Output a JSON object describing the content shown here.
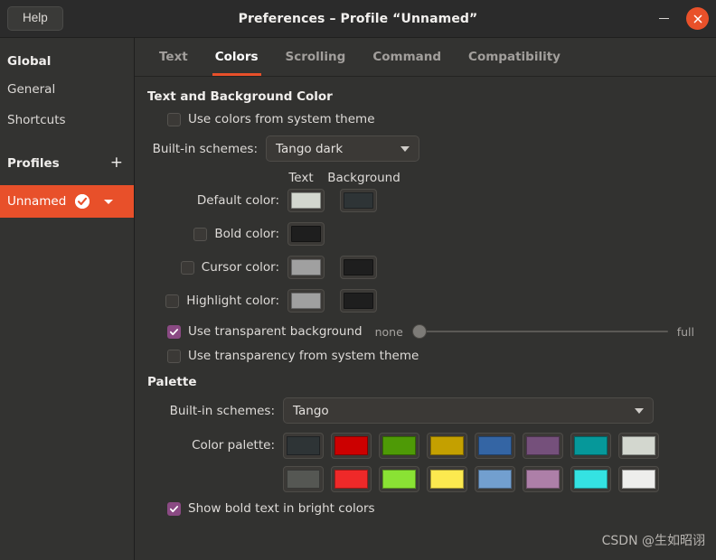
{
  "window": {
    "title": "Preferences – Profile “Unnamed”",
    "help_label": "Help",
    "minimize_icon": "minimize-icon",
    "close_icon": "close-icon",
    "accent_color": "#e8502a"
  },
  "sidebar": {
    "global_header": "Global",
    "items": [
      {
        "label": "General"
      },
      {
        "label": "Shortcuts"
      }
    ],
    "profiles_header": "Profiles",
    "add_profile_icon": "plus-icon",
    "profile": {
      "name": "Unnamed",
      "selected_icon": "check-circle-icon",
      "menu_icon": "chevron-down-icon",
      "highlight_color": "#e8502a"
    }
  },
  "tabs": [
    {
      "label": "Text",
      "active": false
    },
    {
      "label": "Colors",
      "active": true
    },
    {
      "label": "Scrolling",
      "active": false
    },
    {
      "label": "Command",
      "active": false
    },
    {
      "label": "Compatibility",
      "active": false
    }
  ],
  "text_bg_section": {
    "title": "Text and Background Color",
    "use_system_theme": {
      "label": "Use colors from system theme",
      "checked": false
    },
    "builtin_schemes": {
      "label": "Built-in schemes:",
      "value": "Tango dark"
    },
    "column_headers": {
      "text": "Text",
      "background": "Background"
    },
    "color_rows": [
      {
        "label": "Default color:",
        "has_checkbox": false,
        "checked": false,
        "text_color": "#d3d7cf",
        "background_color": "#2e3436"
      },
      {
        "label": "Bold color:",
        "has_checkbox": true,
        "checked": false,
        "text_color": "#1e1e1e",
        "background_color": null
      },
      {
        "label": "Cursor color:",
        "has_checkbox": true,
        "checked": false,
        "text_color": "#a0a0a0",
        "background_color": "#1e1e1e"
      },
      {
        "label": "Highlight color:",
        "has_checkbox": true,
        "checked": false,
        "text_color": "#a0a0a0",
        "background_color": "#1e1e1e"
      }
    ],
    "transparent_background": {
      "label": "Use transparent background",
      "checked": true,
      "slider_min_label": "none",
      "slider_max_label": "full",
      "slider_value": 0
    },
    "transparency_system_theme": {
      "label": "Use transparency from system theme",
      "checked": false
    }
  },
  "palette_section": {
    "title": "Palette",
    "builtin_schemes": {
      "label": "Built-in schemes:",
      "value": "Tango"
    },
    "palette_label": "Color palette:",
    "palette_row_1": [
      "#2e3436",
      "#cc0000",
      "#4e9a06",
      "#c4a000",
      "#3465a4",
      "#75507b",
      "#06989a",
      "#d3d7cf"
    ],
    "palette_row_2": [
      "#555753",
      "#ef2929",
      "#8ae234",
      "#fce94f",
      "#729fcf",
      "#ad7fa8",
      "#34e2e2",
      "#eeeeec"
    ],
    "bold_bright": {
      "label": "Show bold text in bright colors",
      "checked": true
    }
  },
  "watermark": "CSDN @生如昭诩"
}
